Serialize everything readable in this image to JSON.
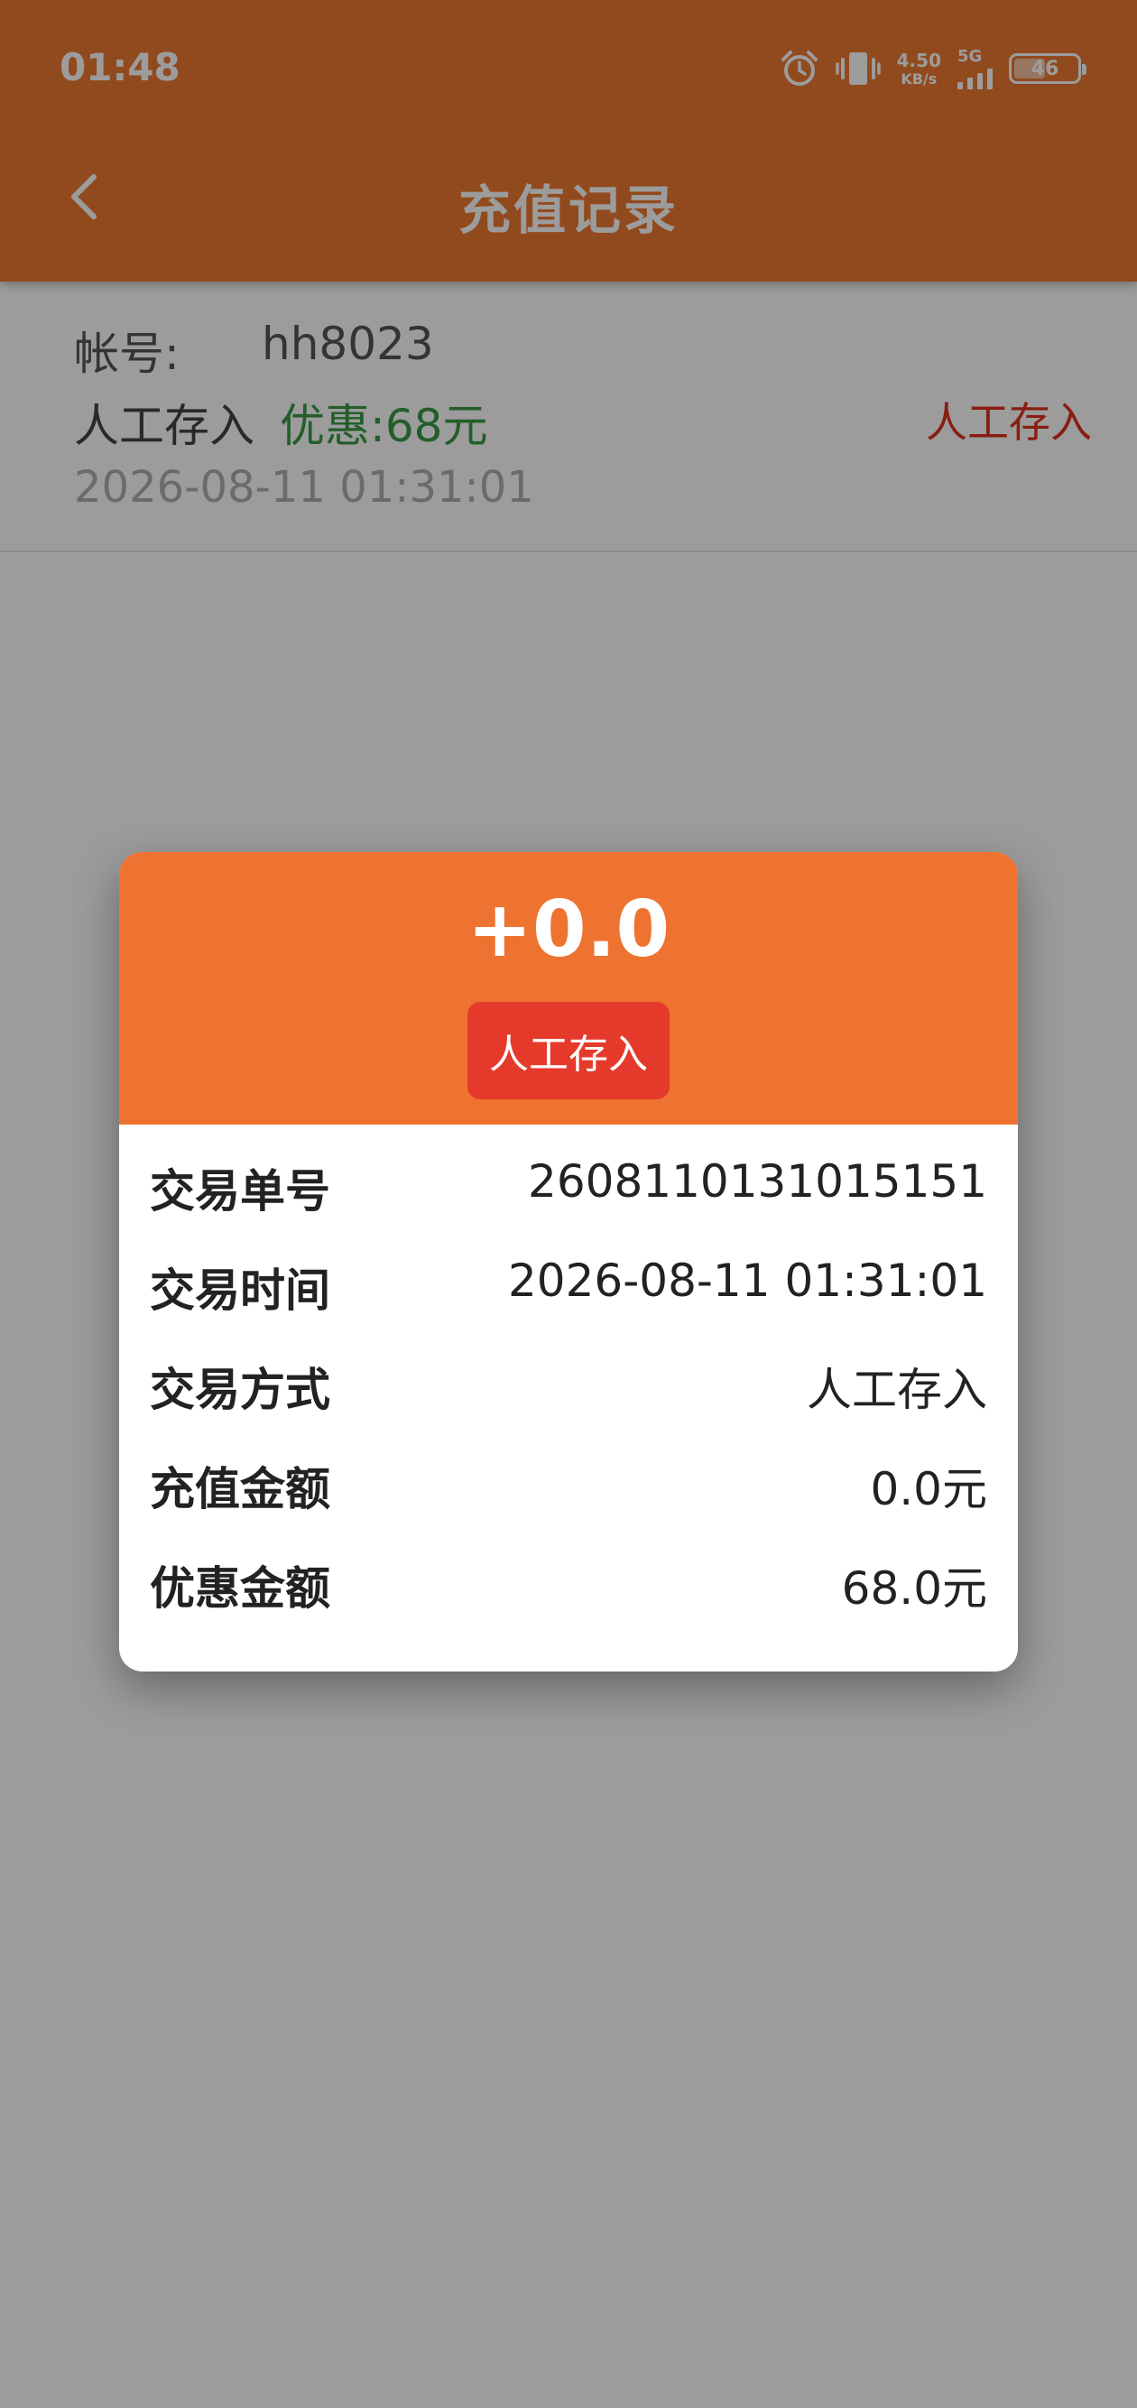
{
  "status_bar": {
    "time": "01:48",
    "net_speed_value": "4.50",
    "net_speed_unit": "KB/s",
    "network_type": "5G",
    "battery_level": "46"
  },
  "header": {
    "title": "充值记录",
    "back_icon": "chevron-left-icon"
  },
  "record": {
    "account_label": "帐号:",
    "account_value": "hh8023",
    "type": "人工存入",
    "promo": "优惠:68元",
    "status": "人工存入",
    "time": "2026-08-11 01:31:01"
  },
  "dialog": {
    "amount": "+0.0",
    "badge": "人工存入",
    "rows": [
      {
        "label": "交易单号",
        "value": "2608110131015151"
      },
      {
        "label": "交易时间",
        "value": "2026-08-11 01:31:01"
      },
      {
        "label": "交易方式",
        "value": "人工存入"
      },
      {
        "label": "充值金额",
        "value": "0.0元"
      },
      {
        "label": "优惠金额",
        "value": "68.0元"
      }
    ]
  },
  "colors": {
    "header": "#ee7a31",
    "dialog_header": "#ee7330",
    "badge": "#e53a2b",
    "promo_green": "#3a9a45",
    "status_red": "#e0301e"
  }
}
